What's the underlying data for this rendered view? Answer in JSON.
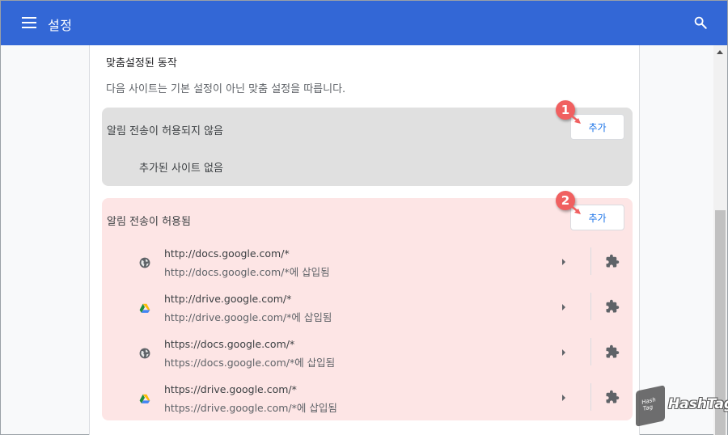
{
  "header": {
    "title": "설정",
    "menu_icon": "hamburger-menu-icon",
    "search_icon": "search-icon",
    "color": "#3367d6"
  },
  "section": {
    "title": "맞춤설정된 동작",
    "description": "다음 사이트는 기본 설정이 아닌 맞춤 설정을 따릅니다."
  },
  "blocked": {
    "label": "알림 전송이 허용되지 않음",
    "add_label": "추가",
    "empty_text": "추가된 사이트 없음",
    "bg_color": "#e0e0e0"
  },
  "allowed": {
    "label": "알림 전송이 허용됨",
    "add_label": "추가",
    "bg_color": "#fde5e5",
    "sites": [
      {
        "url": "http://docs.google.com/*",
        "sub": "http://docs.google.com/*에 삽입됨",
        "icon": "globe-icon"
      },
      {
        "url": "http://drive.google.com/*",
        "sub": "http://drive.google.com/*에 삽입됨",
        "icon": "google-drive-icon"
      },
      {
        "url": "https://docs.google.com/*",
        "sub": "https://docs.google.com/*에 삽입됨",
        "icon": "globe-icon"
      },
      {
        "url": "https://drive.google.com/*",
        "sub": "https://drive.google.com/*에 삽입됨",
        "icon": "google-drive-icon"
      }
    ]
  },
  "annotations": {
    "badge1": "1",
    "badge2": "2",
    "badge_color": "#f06060"
  },
  "watermark": {
    "box_top": "Hash",
    "box_bottom": "Tag",
    "text": "HashTag"
  }
}
